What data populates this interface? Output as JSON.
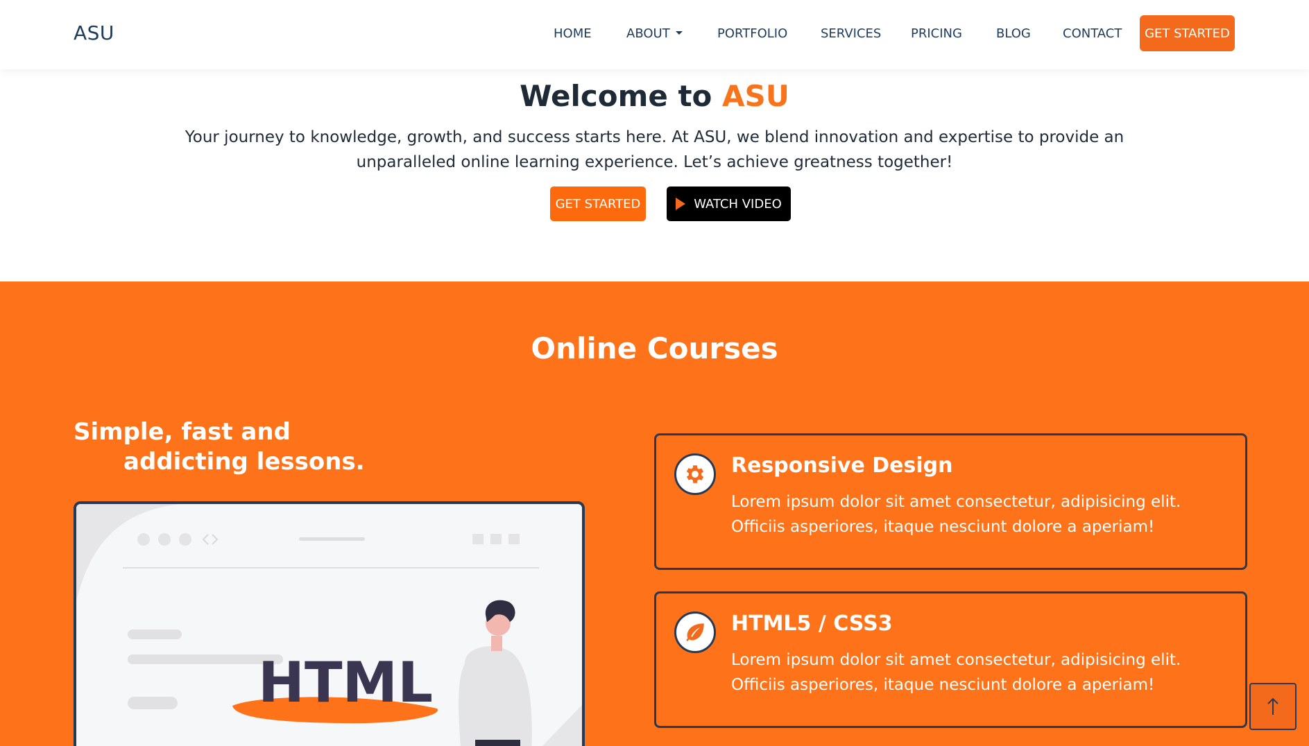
{
  "brand": {
    "name": "ASU",
    "accent_color": "#fe7319",
    "dark_color": "#273a54"
  },
  "nav": {
    "items": [
      {
        "label": "HOME"
      },
      {
        "label": "ABOUT"
      },
      {
        "label": "PORTFOLIO"
      },
      {
        "label": "SERVICES"
      },
      {
        "label": "PRICING"
      },
      {
        "label": "BLOG"
      },
      {
        "label": "CONTACT"
      }
    ],
    "cta_label": "GET STARTED"
  },
  "hero": {
    "title_prefix": "Welcome to ",
    "title_accent": "ASU",
    "description": "Your journey to knowledge, growth, and success starts here. At ASU, we blend innovation and expertise to provide an unparalleled online learning experience. Let’s achieve greatness together!",
    "primary_button": "GET STARTED",
    "secondary_button": "WATCH VIDEO"
  },
  "courses": {
    "title": "Online Courses",
    "tagline_line1": "Simple, fast and",
    "tagline_line2": "addicting lessons.",
    "illustration_word": "HTML",
    "cards": [
      {
        "icon": "gear-icon",
        "title": "Responsive Design",
        "text": "Lorem ipsum dolor sit amet consectetur, adipisicing elit. Officiis asperiores, itaque nesciunt dolore a aperiam!"
      },
      {
        "icon": "leaf-icon",
        "title": "HTML5 / CSS3",
        "text": "Lorem ipsum dolor sit amet consectetur, adipisicing elit. Officiis asperiores, itaque nesciunt dolore a aperiam!"
      }
    ]
  }
}
